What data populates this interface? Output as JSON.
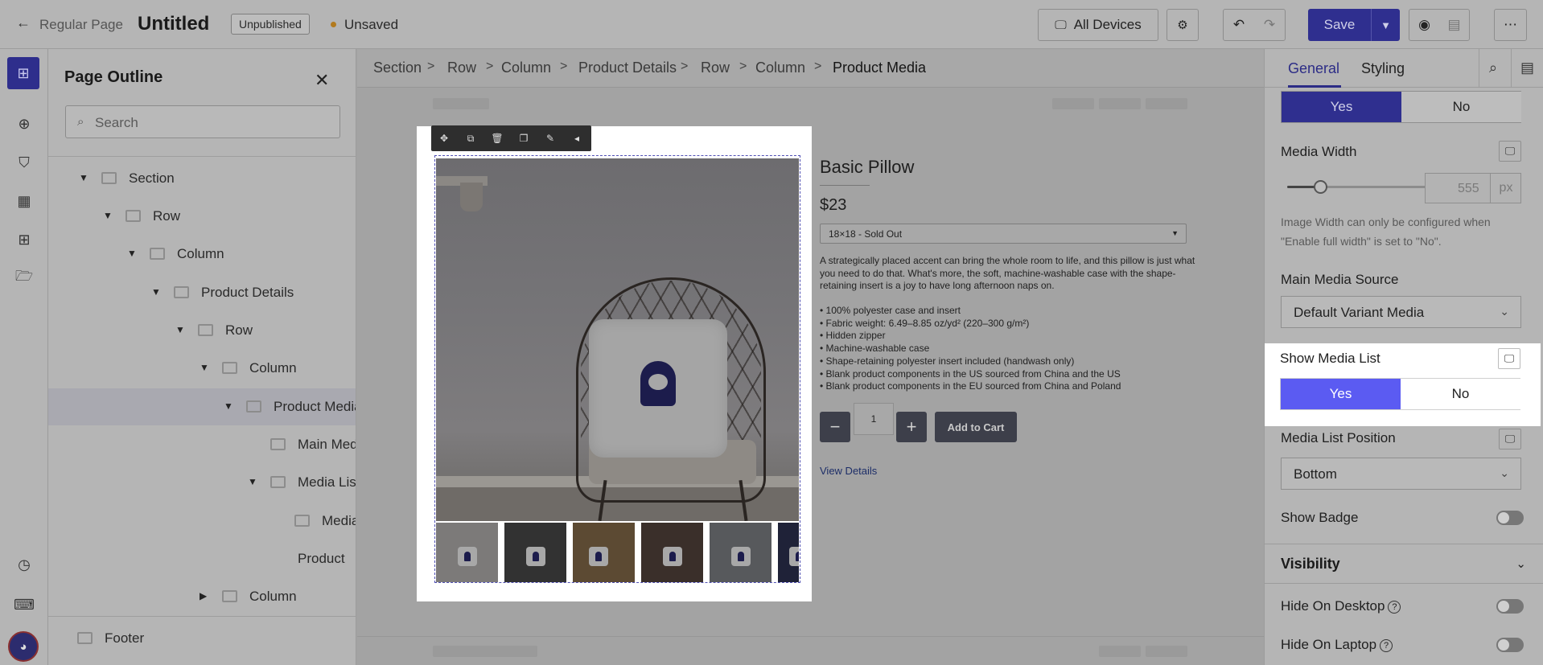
{
  "topbar": {
    "page_type": "Regular Page",
    "title": "Untitled",
    "status_badge": "Unpublished",
    "save_state": "Unsaved",
    "device_selector": "All Devices",
    "save_label": "Save"
  },
  "outline": {
    "title": "Page Outline",
    "search_placeholder": "Search",
    "nodes": [
      {
        "label": "Section"
      },
      {
        "label": "Row"
      },
      {
        "label": "Column"
      },
      {
        "label": "Product Details"
      },
      {
        "label": "Row"
      },
      {
        "label": "Column"
      },
      {
        "label": "Product Media"
      },
      {
        "label": "Main Media"
      },
      {
        "label": "Media List"
      },
      {
        "label": "Media"
      },
      {
        "label": "Product"
      },
      {
        "label": "Column"
      },
      {
        "label": "Footer"
      }
    ]
  },
  "breadcrumb": [
    "Section",
    "Row",
    "Column",
    "Product Details",
    "Row",
    "Column",
    "Product Media"
  ],
  "product": {
    "name": "Basic Pillow",
    "price": "$23",
    "variant": "18×18 - Sold Out",
    "description": "A strategically placed accent can bring the whole room to life, and this pillow is just what you need to do that. What's more, the soft, machine-washable case with the shape-retaining insert is a joy to have long afternoon naps on.",
    "bullets": [
      "• 100% polyester case and insert",
      "• Fabric weight: 6.49–8.85 oz/yd² (220–300 g/m²)",
      "• Hidden zipper",
      "• Machine-washable case",
      "• Shape-retaining polyester insert included (handwash only)",
      "• Blank product components in the US sourced from China and the US",
      "• Blank product components in the EU sourced from China and Poland"
    ],
    "quantity": "1",
    "add_to_cart": "Add to Cart",
    "view_details": "View Details"
  },
  "settings": {
    "tabs": [
      "General",
      "Styling"
    ],
    "yes": "Yes",
    "no": "No",
    "media_width_label": "Media Width",
    "media_width_value": "555",
    "media_width_unit": "px",
    "media_width_help": "Image Width can only be configured when \"Enable full width\" is set to \"No\".",
    "main_media_source_label": "Main Media Source",
    "main_media_source_value": "Default Variant Media",
    "show_media_list_label": "Show Media List",
    "media_list_position_label": "Media List Position",
    "media_list_position_value": "Bottom",
    "show_badge_label": "Show Badge",
    "visibility_header": "Visibility",
    "hide_on_desktop": "Hide On Desktop",
    "hide_on_laptop": "Hide On Laptop"
  },
  "colors": {
    "accent": "#2f2f8f",
    "highlight_yes": "#5b5bf2",
    "unsaved_dot": "#e0a030"
  }
}
